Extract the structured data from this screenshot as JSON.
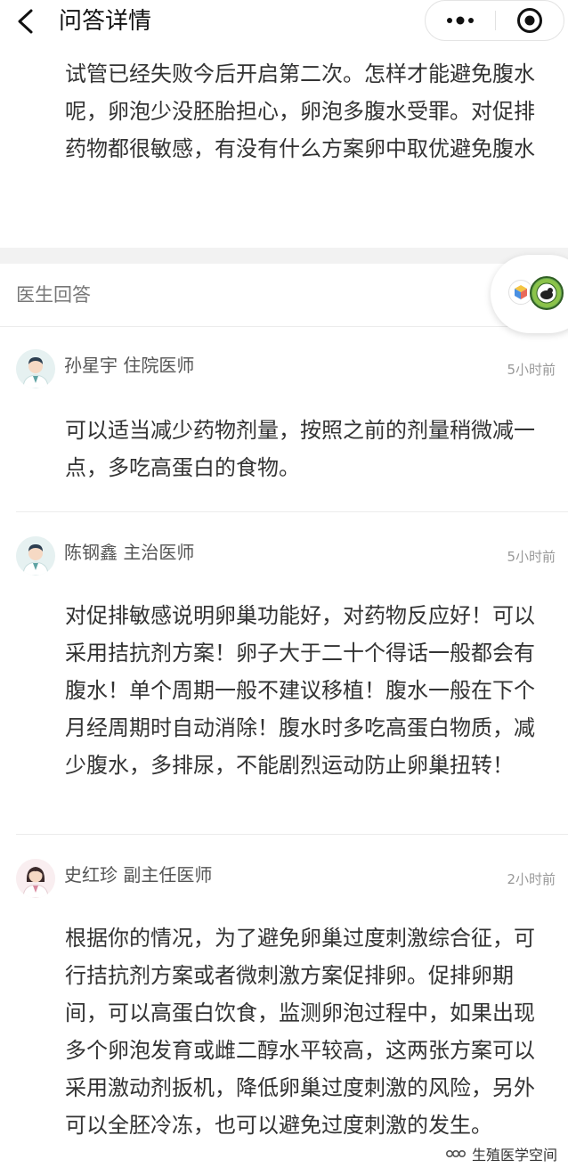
{
  "navbar": {
    "title": "问答详情",
    "more_icon": "more-dots-icon",
    "close_icon": "target-close-icon"
  },
  "question": {
    "text": "试管已经失败今后开启第二次。怎样才能避免腹水呢，卵泡少没胚胎担心，卵泡多腹水受罪。对促排药物都很敏感，有没有什么方案卵中取优避免腹水"
  },
  "section": {
    "title": "医生回答"
  },
  "answers": [
    {
      "doctor": "孙星宇 住院医师",
      "time": "5小时前",
      "avatar": "male-doctor-avatar",
      "text": "可以适当减少药物剂量，按照之前的剂量稍微减一点，多吃高蛋白的食物。"
    },
    {
      "doctor": "陈钢鑫 主治医师",
      "time": "5小时前",
      "avatar": "male-doctor-avatar",
      "text": "对促排敏感说明卵巢功能好，对药物反应好！可以采用拮抗剂方案！卵子大于二十个得话一般都会有腹水！单个周期一般不建议移植！腹水一般在下个月经周期时自动消除！腹水时多吃高蛋白物质，减少腹水，多排尿，不能剧烈运动防止卵巢扭转！"
    },
    {
      "doctor": "史红珍 副主任医师",
      "time": "2小时前",
      "avatar": "female-doctor-avatar",
      "text": "根据你的情况，为了避免卵巢过度刺激综合征，可行拮抗剂方案或者微刺激方案促排卵。促排卵期间，可以高蛋白饮食，监测卵泡过程中，如果出现多个卵泡发育或雌二醇水平较高，这两张方案可以采用激动剂扳机，降低卵巢过度刺激的风险，另外可以全胚冷冻，也可以避免过度刺激的发生。"
    }
  ],
  "watermark": {
    "text": "生殖医学空间",
    "icon": "wechat-channel-icon"
  },
  "colors": {
    "text": "#333333",
    "muted": "#999999",
    "section_bg": "#f2f2f2"
  }
}
